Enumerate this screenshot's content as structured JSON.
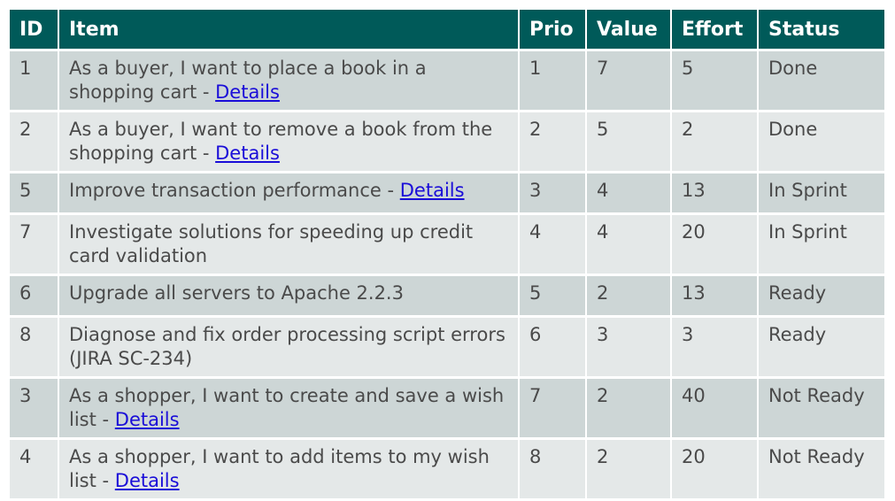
{
  "headers": {
    "id": "ID",
    "item": "Item",
    "prio": "Prio",
    "value": "Value",
    "effort": "Effort",
    "status": "Status"
  },
  "rows": [
    {
      "id": "1",
      "item": "As a buyer, I want to place a book in a shopping cart - ",
      "link": "Details",
      "prio": "1",
      "value": "7",
      "effort": "5",
      "status": "Done"
    },
    {
      "id": "2",
      "item": "As a buyer, I want to remove a book from the shopping cart - ",
      "link": "Details",
      "prio": "2",
      "value": "5",
      "effort": "2",
      "status": "Done"
    },
    {
      "id": "5",
      "item": "Improve transaction performance - ",
      "link": "Details",
      "prio": "3",
      "value": "4",
      "effort": "13",
      "status": "In Sprint"
    },
    {
      "id": "7",
      "item": "Investigate solutions for speeding up credit card validation",
      "link": "",
      "prio": "4",
      "value": "4",
      "effort": "20",
      "status": "In Sprint"
    },
    {
      "id": "6",
      "item": "Upgrade all servers to Apache 2.2.3",
      "link": "",
      "prio": "5",
      "value": "2",
      "effort": "13",
      "status": "Ready"
    },
    {
      "id": "8",
      "item": "Diagnose and fix order processing script errors (JIRA SC-234)",
      "link": "",
      "prio": "6",
      "value": "3",
      "effort": "3",
      "status": "Ready"
    },
    {
      "id": "3",
      "item": "As a shopper, I want to create and save a wish list - ",
      "link": "Details",
      "prio": "7",
      "value": "2",
      "effort": "40",
      "status": "Not Ready"
    },
    {
      "id": "4",
      "item": "As a shopper, I want to add items to my wish list - ",
      "link": "Details",
      "prio": "8",
      "value": "2",
      "effort": "20",
      "status": "Not Ready"
    }
  ],
  "colors": {
    "header_bg": "#005a59",
    "row_odd": "#cdd6d6",
    "row_even": "#e4e8e8",
    "link": "#1a0dd8"
  }
}
